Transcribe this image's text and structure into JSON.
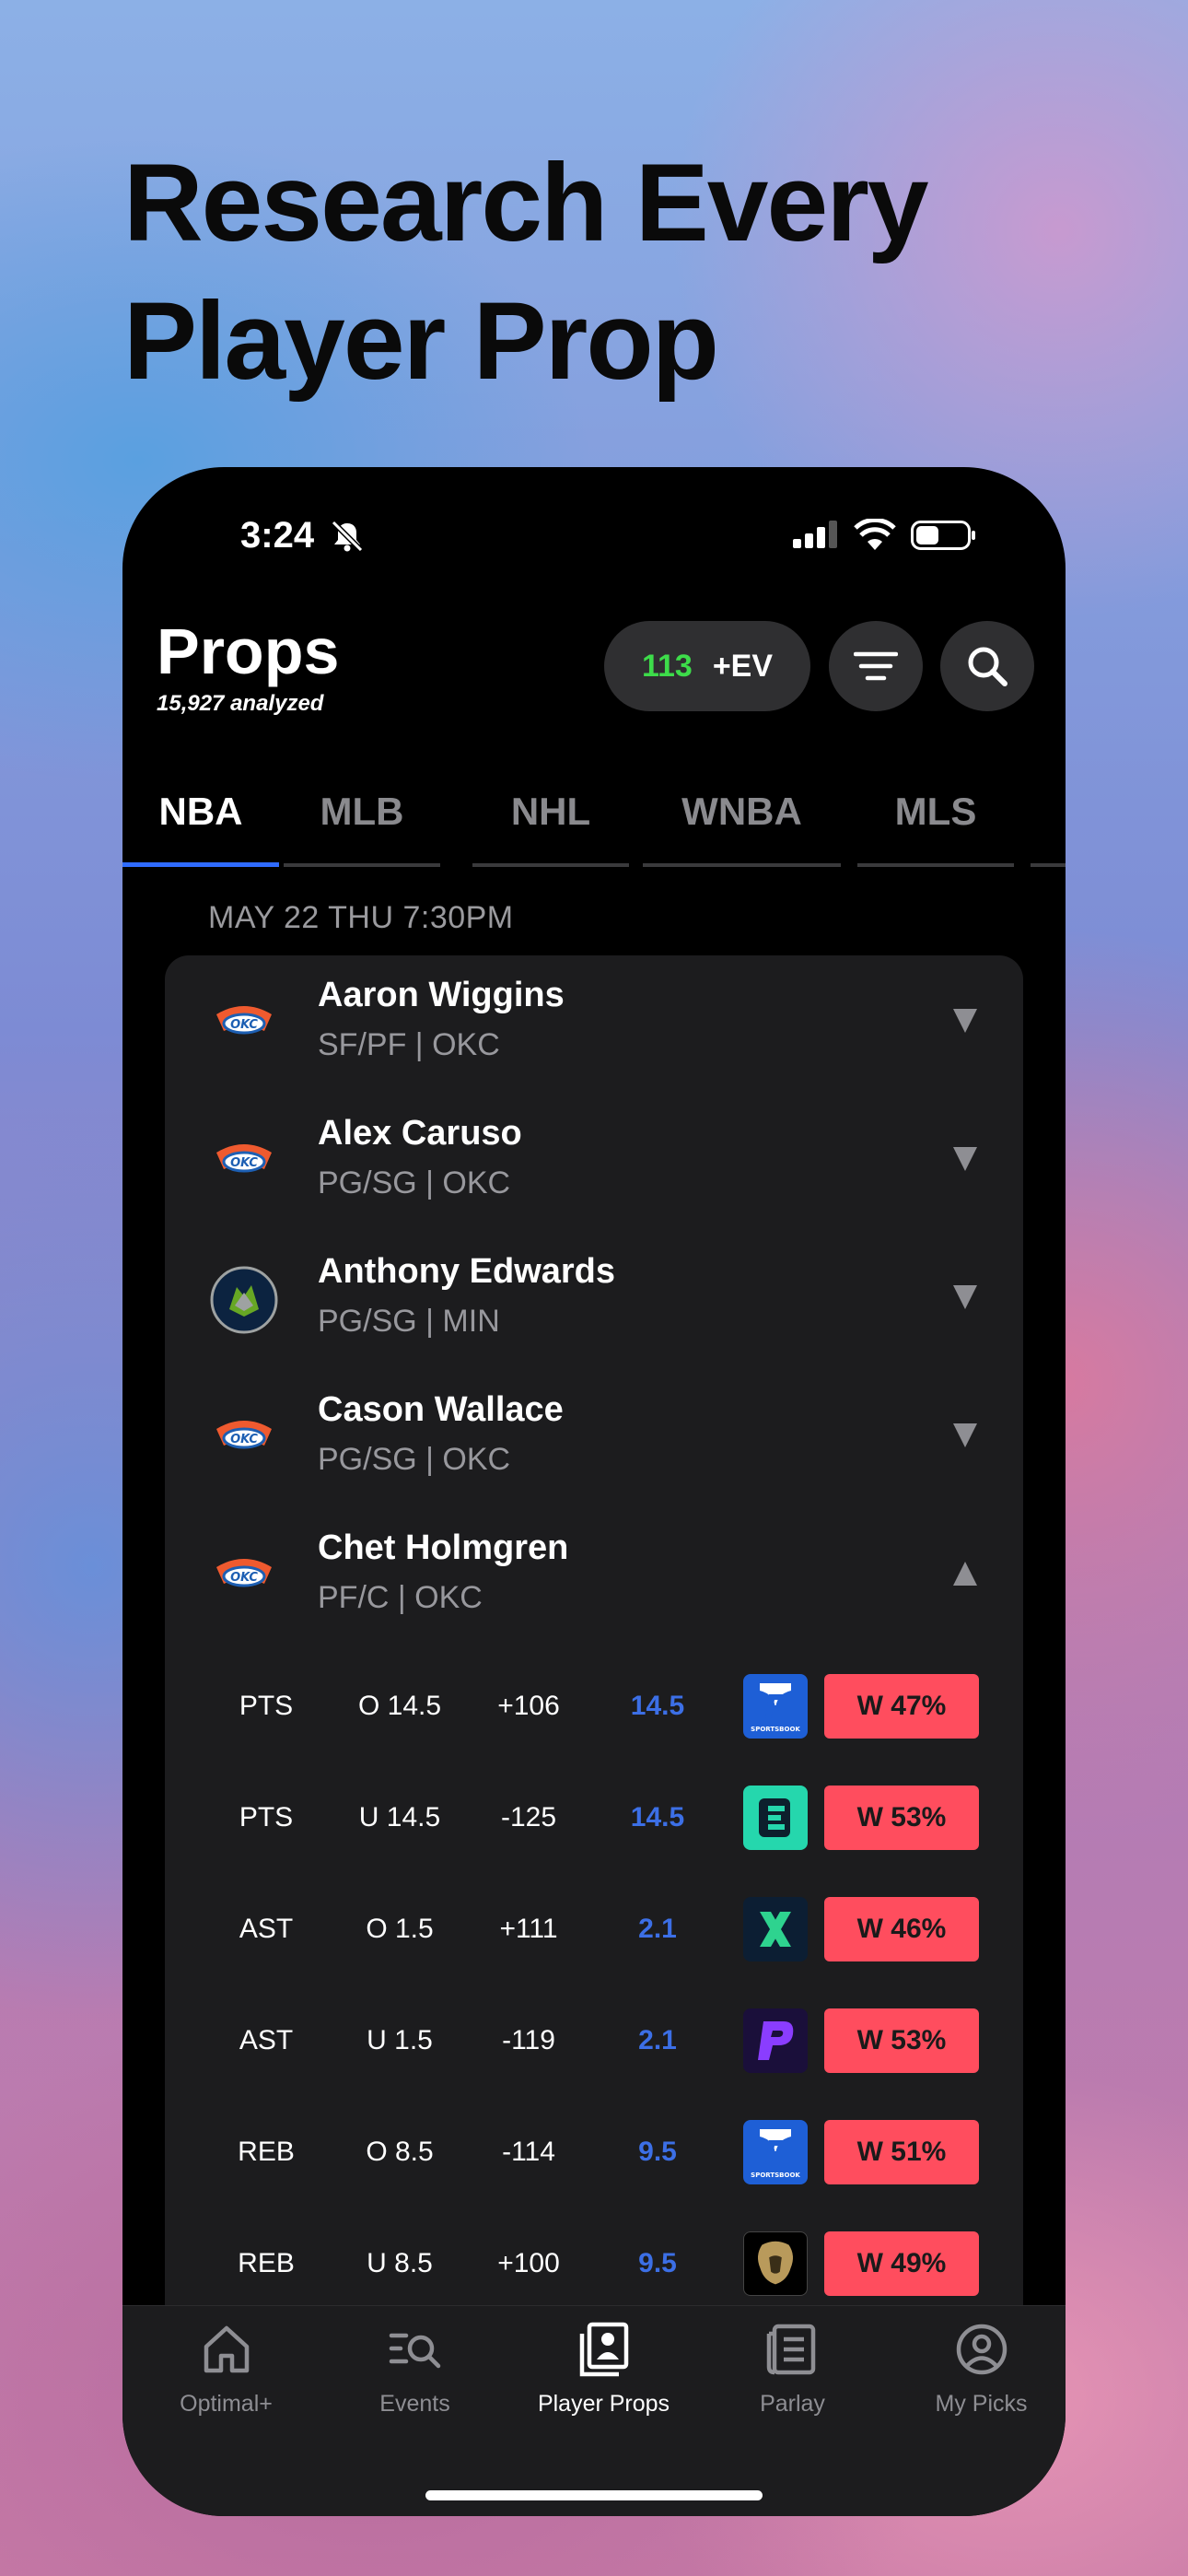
{
  "headline": {
    "line1": "Research Every",
    "line2": "Player Prop"
  },
  "status_bar": {
    "time": "3:24"
  },
  "header": {
    "title": "Props",
    "subtitle": "15,927 analyzed",
    "ev_count": "113",
    "ev_label": "+EV"
  },
  "tabs": [
    {
      "label": "NBA",
      "active": true
    },
    {
      "label": "MLB"
    },
    {
      "label": "NHL"
    },
    {
      "label": "WNBA"
    },
    {
      "label": "MLS"
    }
  ],
  "game": {
    "date_label": "MAY 22 THU 7:30PM"
  },
  "players": [
    {
      "name": "Aaron Wiggins",
      "position": "SF/PF | OKC",
      "team": "OKC",
      "expanded": false
    },
    {
      "name": "Alex Caruso",
      "position": "PG/SG | OKC",
      "team": "OKC",
      "expanded": false
    },
    {
      "name": "Anthony Edwards",
      "position": "PG/SG | MIN",
      "team": "MIN",
      "expanded": false
    },
    {
      "name": "Cason Wallace",
      "position": "PG/SG | OKC",
      "team": "OKC",
      "expanded": false
    },
    {
      "name": "Chet Holmgren",
      "position": "PF/C | OKC",
      "team": "OKC",
      "expanded": true
    }
  ],
  "props": [
    {
      "stat": "PTS",
      "line": "O 14.5",
      "odds": "+106",
      "projection": "14.5",
      "book": "fanduel",
      "win": "W 47%"
    },
    {
      "stat": "PTS",
      "line": "U 14.5",
      "odds": "-125",
      "projection": "14.5",
      "book": "espnbet",
      "win": "W 53%"
    },
    {
      "stat": "AST",
      "line": "O 1.5",
      "odds": "+111",
      "projection": "2.1",
      "book": "betrivers-x",
      "win": "W 46%"
    },
    {
      "stat": "AST",
      "line": "U 1.5",
      "odds": "-119",
      "projection": "2.1",
      "book": "prizepicks",
      "win": "W 53%"
    },
    {
      "stat": "REB",
      "line": "O 8.5",
      "odds": "-114",
      "projection": "9.5",
      "book": "fanduel",
      "win": "W 51%"
    },
    {
      "stat": "REB",
      "line": "U 8.5",
      "odds": "+100",
      "projection": "9.5",
      "book": "betmgm",
      "win": "W 49%"
    }
  ],
  "book_logos": {
    "fanduel_caption": "SPORTSBOOK"
  },
  "tabbar": [
    {
      "label": "Optimal+",
      "icon": "home-icon"
    },
    {
      "label": "Events",
      "icon": "events-search-icon"
    },
    {
      "label": "Player Props",
      "icon": "player-card-icon",
      "active": true
    },
    {
      "label": "Parlay",
      "icon": "parlay-ticket-icon"
    },
    {
      "label": "My Picks",
      "icon": "user-circle-icon"
    }
  ],
  "colors": {
    "accent_blue": "#2f6bff",
    "ev_green": "#3ddc4a",
    "win_red": "#ff4d5e",
    "projection_blue": "#3c6fe6"
  }
}
